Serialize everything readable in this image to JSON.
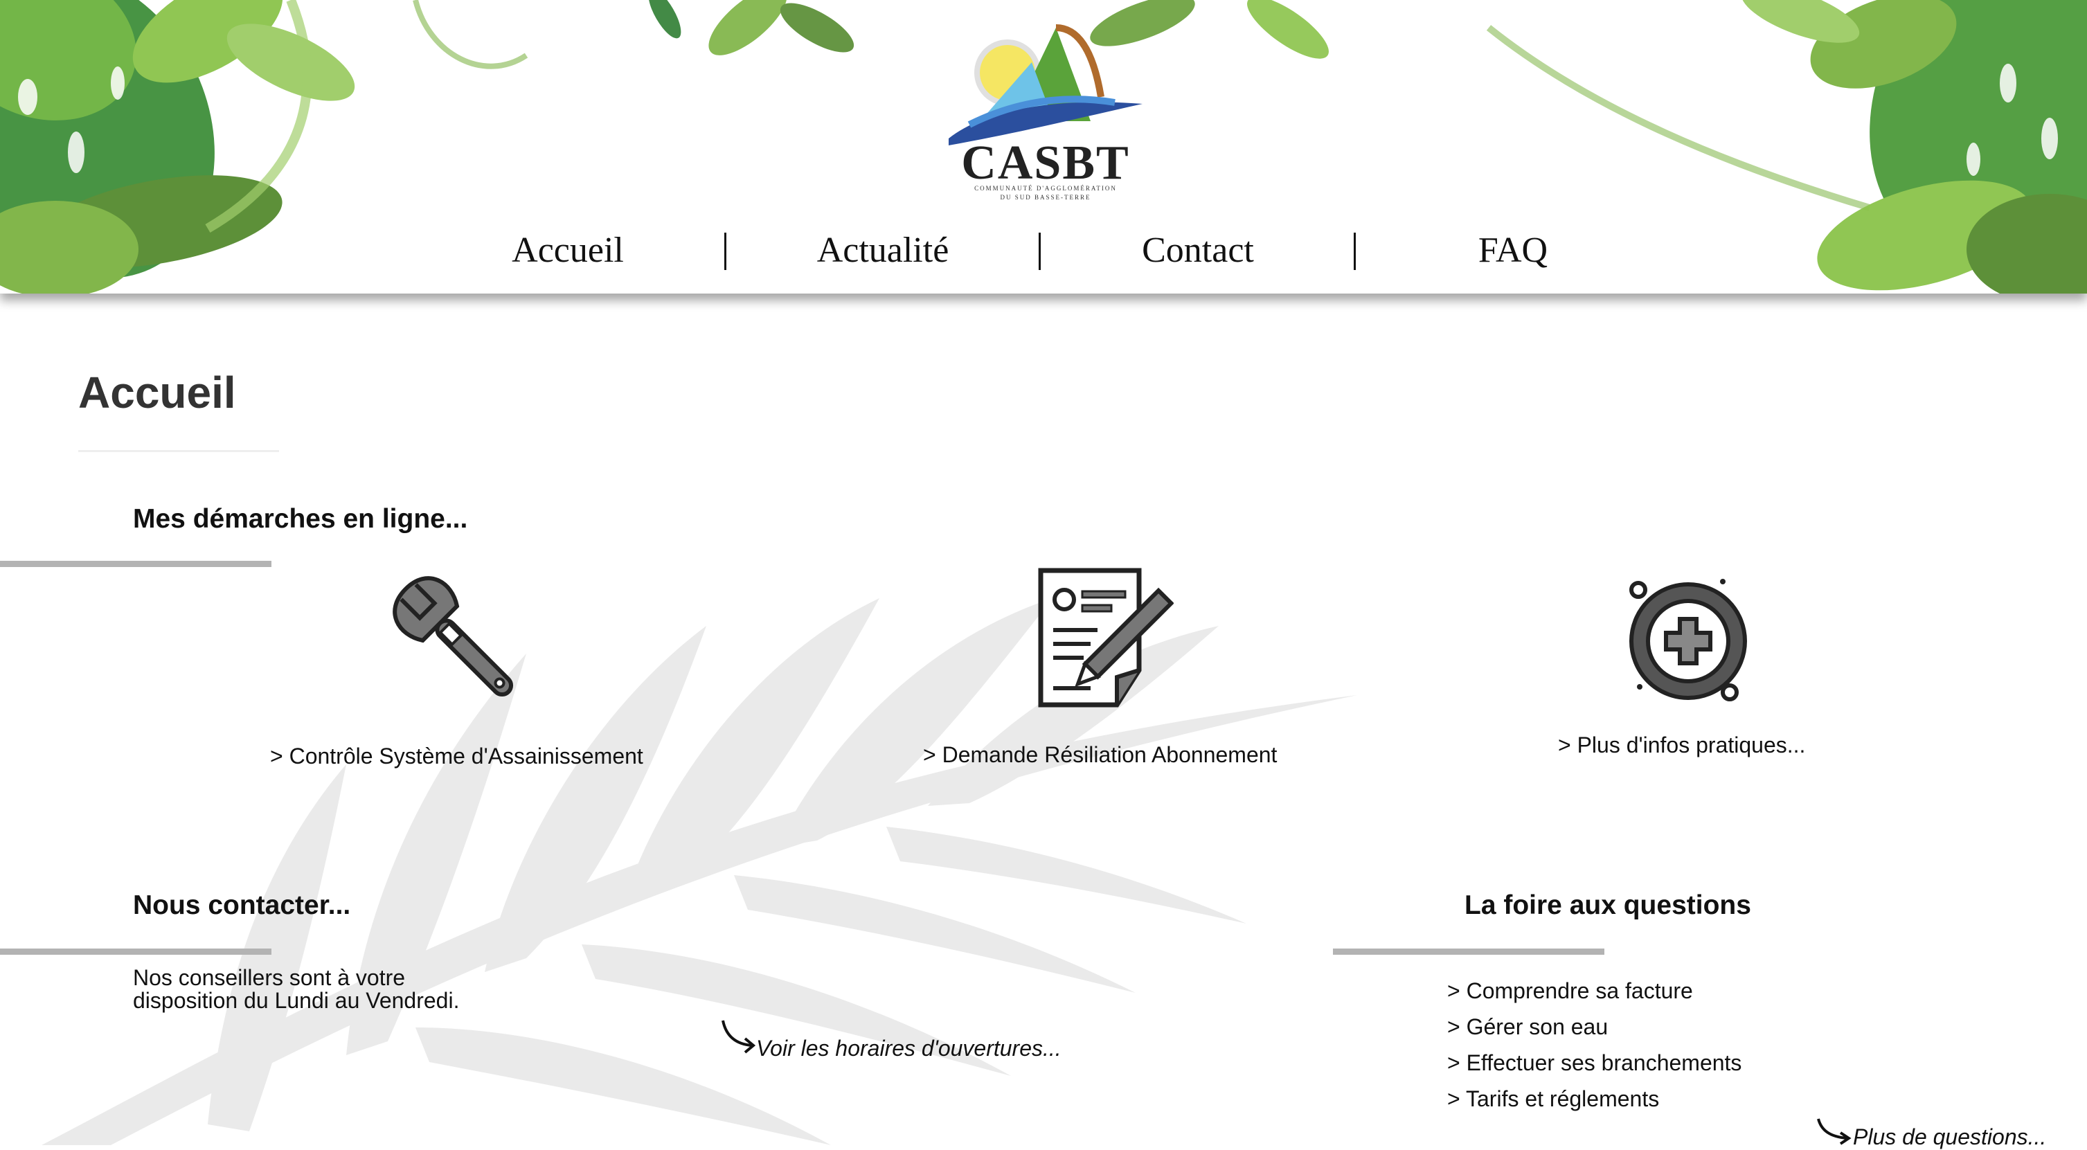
{
  "header": {
    "logo_text": "CASBT",
    "logo_subtitle_line1": "COMMUNAUTÉ D'AGGLOMÉRATION",
    "logo_subtitle_line2": "DU SUD BASSE-TERRE",
    "nav": [
      {
        "label": "Accueil"
      },
      {
        "label": "Actualité"
      },
      {
        "label": "Contact"
      },
      {
        "label": "FAQ"
      }
    ]
  },
  "main": {
    "page_title": "Accueil",
    "demarches": {
      "heading": "Mes démarches en ligne...",
      "cards": [
        {
          "icon": "wrench-icon",
          "label": "> Contrôle Système d'Assainissement"
        },
        {
          "icon": "document-pen-icon",
          "label": "> Demande Résiliation Abonnement"
        },
        {
          "icon": "plus-circle-icon",
          "label": "> Plus d'infos pratiques..."
        }
      ]
    },
    "contact": {
      "heading": "Nous contacter...",
      "text_line1": "Nos conseillers sont à votre",
      "text_line2": "disposition du Lundi au Vendredi.",
      "hours_link": "Voir les horaires d'ouvertures..."
    },
    "faq": {
      "heading": "La foire aux questions",
      "items": [
        {
          "label": "> Comprendre sa facture"
        },
        {
          "label": "> Gérer son eau"
        },
        {
          "label": "> Effectuer ses branchements"
        },
        {
          "label": "> Tarifs et réglements"
        }
      ],
      "more_link": "Plus de questions..."
    }
  },
  "colors": {
    "accent_rule": "#b3b3b3",
    "foliage_dark": "#2e7d32",
    "foliage_light": "#8bc34a"
  }
}
